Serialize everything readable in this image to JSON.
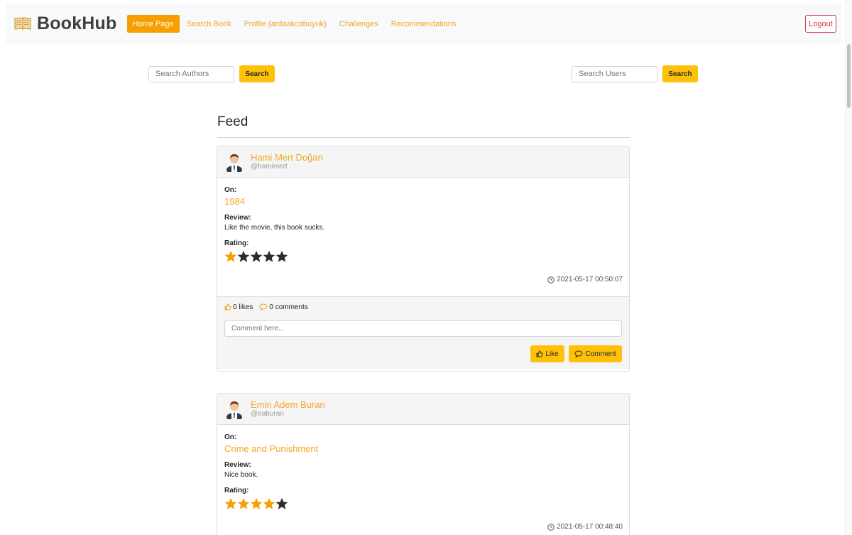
{
  "app": {
    "brand": "BookHub",
    "brand_icon": "book-open-icon"
  },
  "nav": {
    "items": [
      {
        "label": "Home Page",
        "active": true
      },
      {
        "label": "Search Book"
      },
      {
        "label": "Profile (ardaakcabuyuk)"
      },
      {
        "label": "Challenges"
      },
      {
        "label": "Recommendations"
      }
    ],
    "logout_label": "Logout"
  },
  "search_authors": {
    "placeholder": "Search Authors",
    "button": "Search"
  },
  "search_users": {
    "placeholder": "Search Users",
    "button": "Search"
  },
  "feed": {
    "title": "Feed",
    "posts": [
      {
        "name": "Hami Mert Doğan",
        "handle": "@hamimert",
        "on_label": "On:",
        "book": "1984",
        "review_label": "Review:",
        "review": "Like the movie, this book sucks.",
        "rating_label": "Rating:",
        "rating": 1,
        "rating_max": 5,
        "timestamp": "2021-05-17 00:50:07",
        "likes": "0 likes",
        "comments": "0 comments",
        "comment_placeholder": "Comment here...",
        "like_button": "Like",
        "comment_button": "Comment"
      },
      {
        "name": "Emin Adem Buran",
        "handle": "@eaburan",
        "on_label": "On:",
        "book": "Crime and Punishment",
        "review_label": "Review:",
        "review": "Nice book.",
        "rating_label": "Rating:",
        "rating": 4,
        "rating_max": 5,
        "timestamp": "2021-05-17 00:48:40"
      }
    ]
  },
  "colors": {
    "accent": "#f79e00",
    "link": "#f5a623",
    "button": "#ffc107",
    "danger": "#dc3545",
    "star_empty": "#2b2b2b"
  }
}
